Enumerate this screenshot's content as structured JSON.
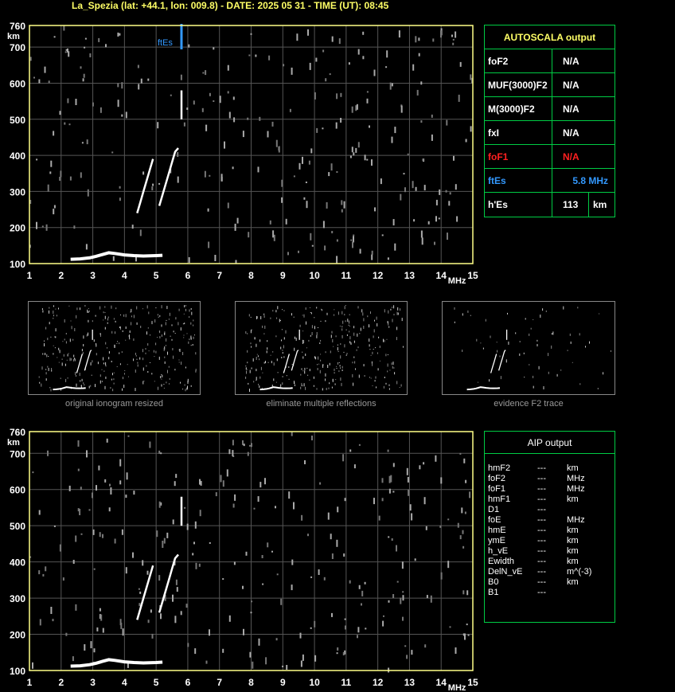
{
  "header": {
    "title": "La_Spezia (lat: +44.1, lon: 009.8) - DATE: 2025 05 31 - TIME (UT): 08:45"
  },
  "colors": {
    "axis": "#ffff88",
    "grid": "#555555",
    "panel_border": "#00cc44",
    "label_yellow": "#ffff66",
    "fof1_red": "#ff2020",
    "ftes_blue": "#3399ff"
  },
  "chart_data": [
    {
      "type": "scatter",
      "name_hint": "ionogram",
      "x_unit": "MHz",
      "y_unit": "km",
      "xlim": [
        1,
        15
      ],
      "ylim": [
        100,
        760
      ],
      "x_ticks": [
        "1",
        "2",
        "3",
        "4",
        "5",
        "6",
        "7",
        "8",
        "9",
        "10",
        "11",
        "12",
        "13",
        "14",
        "15"
      ],
      "y_ticks": [
        "100",
        "200",
        "300",
        "400",
        "500",
        "600",
        "700",
        "760"
      ],
      "grid": true,
      "ftes_marker": {
        "label": "ftEs",
        "x": 5.8
      },
      "traces": [
        {
          "name": "E layer",
          "points": [
            [
              2.3,
              112
            ],
            [
              2.6,
              113
            ],
            [
              2.9,
              116
            ],
            [
              3.1,
              120
            ],
            [
              3.3,
              125
            ],
            [
              3.5,
              130
            ],
            [
              3.7,
              128
            ],
            [
              4.0,
              124
            ],
            [
              4.3,
              122
            ],
            [
              4.6,
              121
            ],
            [
              5.0,
              122
            ],
            [
              5.2,
              123
            ]
          ]
        },
        {
          "name": "trace A",
          "points": [
            [
              4.4,
              240
            ],
            [
              4.5,
              270
            ],
            [
              4.6,
              300
            ],
            [
              4.7,
              330
            ],
            [
              4.8,
              360
            ],
            [
              4.9,
              390
            ]
          ]
        },
        {
          "name": "trace B",
          "points": [
            [
              5.1,
              260
            ],
            [
              5.2,
              290
            ],
            [
              5.3,
              320
            ],
            [
              5.4,
              350
            ],
            [
              5.5,
              380
            ],
            [
              5.6,
              410
            ],
            [
              5.7,
              420
            ]
          ]
        },
        {
          "name": "es",
          "points": [
            [
              5.8,
              500
            ],
            [
              5.8,
              540
            ],
            [
              5.8,
              580
            ]
          ]
        }
      ]
    }
  ],
  "autoscala": {
    "title": "AUTOSCALA output",
    "rows": [
      {
        "label": "foF2",
        "value": "N/A",
        "color": "#ffffff"
      },
      {
        "label": "MUF(3000)F2",
        "value": "N/A",
        "color": "#ffffff"
      },
      {
        "label": "M(3000)F2",
        "value": "N/A",
        "color": "#ffffff"
      },
      {
        "label": "fxI",
        "value": "N/A",
        "color": "#ffffff"
      },
      {
        "label": "foF1",
        "value": "N/A",
        "color": "#ff2020"
      },
      {
        "label": "ftEs",
        "value": "5.8 MHz",
        "color": "#3399ff"
      },
      {
        "label": "h'Es",
        "value": "113",
        "unit": "km",
        "color": "#ffffff"
      }
    ]
  },
  "thumbnails": [
    {
      "caption": "original ionogram resized"
    },
    {
      "caption": "eliminate multiple reflections"
    },
    {
      "caption": "evidence F2 trace"
    }
  ],
  "aip": {
    "title": "AIP output",
    "rows": [
      {
        "param": "hmF2",
        "value": "---",
        "unit": "km"
      },
      {
        "param": "foF2",
        "value": "---",
        "unit": "MHz"
      },
      {
        "param": "foF1",
        "value": "---",
        "unit": "MHz"
      },
      {
        "param": "hmF1",
        "value": "---",
        "unit": "km"
      },
      {
        "param": "D1",
        "value": "---",
        "unit": ""
      },
      {
        "param": "foE",
        "value": "---",
        "unit": "MHz"
      },
      {
        "param": "hmE",
        "value": "---",
        "unit": "km"
      },
      {
        "param": "ymE",
        "value": "---",
        "unit": "km"
      },
      {
        "param": "h_vE",
        "value": "---",
        "unit": "km"
      },
      {
        "param": "Ewidth",
        "value": "---",
        "unit": "km"
      },
      {
        "param": "DelN_vE",
        "value": "---",
        "unit": "m^(-3)"
      },
      {
        "param": "B0",
        "value": "---",
        "unit": "km"
      },
      {
        "param": "B1",
        "value": "---",
        "unit": ""
      }
    ]
  }
}
